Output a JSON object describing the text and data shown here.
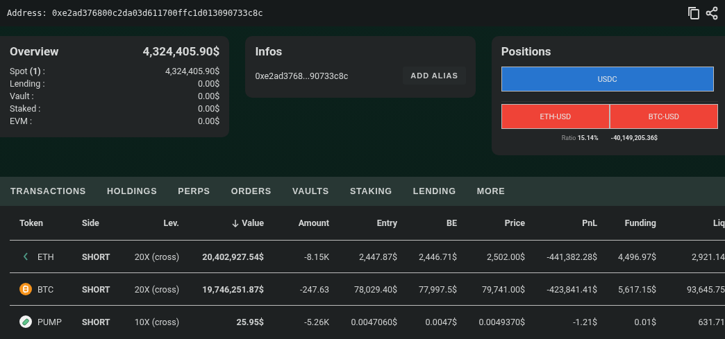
{
  "header": {
    "address_label": "Address:",
    "address": "0xe2ad376800c2da03d611700ffc1d013090733c8c"
  },
  "overview": {
    "title": "Overview",
    "total": "4,324,405.90$",
    "rows": [
      {
        "label": "Spot **(1)** :",
        "value": "4,324,405.90$"
      },
      {
        "label": "Lending :",
        "value": "0.00$"
      },
      {
        "label": "Vault :",
        "value": "0.00$"
      },
      {
        "label": "Staked :",
        "value": "0.00$"
      },
      {
        "label": "EVM :",
        "value": "0.00$"
      }
    ]
  },
  "infos": {
    "title": "Infos",
    "address": "0xe2ad3768...90733c8c",
    "button": "ADD ALIAS"
  },
  "positions": {
    "title": "Positions",
    "long": [
      {
        "label": "USDC"
      }
    ],
    "short": [
      {
        "label": "ETH-USD"
      },
      {
        "label": "BTC-USD"
      }
    ],
    "ratio_label": "Ratio",
    "ratio": "15.14%",
    "net": "-40,149,205.36$"
  },
  "tabs": [
    "TRANSACTIONS",
    "HOLDINGS",
    "PERPS",
    "ORDERS",
    "VAULTS",
    "STAKING",
    "LENDING",
    "MORE"
  ],
  "table": {
    "columns": [
      {
        "label": "Token",
        "sorted": false
      },
      {
        "label": "Side",
        "sorted": false
      },
      {
        "label": "Lev.",
        "sorted": false
      },
      {
        "label": "Value",
        "sorted": true
      },
      {
        "label": "Amount",
        "sorted": false
      },
      {
        "label": "Entry",
        "sorted": false
      },
      {
        "label": "BE",
        "sorted": false
      },
      {
        "label": "Price",
        "sorted": false
      },
      {
        "label": "PnL",
        "sorted": false
      },
      {
        "label": "Funding",
        "sorted": false
      },
      {
        "label": "Liq",
        "sorted": false
      }
    ],
    "rows": [
      {
        "kind": "eth",
        "cells": [
          "ETH",
          "SHORT",
          "20X (cross)",
          "20,402,927.54$",
          "-8.15K",
          "2,447.87$",
          "2,446.71$",
          "2,502.00$",
          "-441,382.28$",
          "4,496.97$",
          "2,921.14"
        ]
      },
      {
        "kind": "btc",
        "cells": [
          "BTC",
          "SHORT",
          "20X (cross)",
          "19,746,251.87$",
          "-247.63",
          "78,029.40$",
          "77,997.5$",
          "79,741.00$",
          "-423,841.41$",
          "5,617.15$",
          "93,645.75"
        ]
      },
      {
        "kind": "pump",
        "cells": [
          "PUMP",
          "SHORT",
          "10X (cross)",
          "25.95$",
          "-5.26K",
          "0.0047060$",
          "0.0047$",
          "0.0049370$",
          "-1.21$",
          "0.01$",
          "631.71"
        ]
      }
    ]
  }
}
